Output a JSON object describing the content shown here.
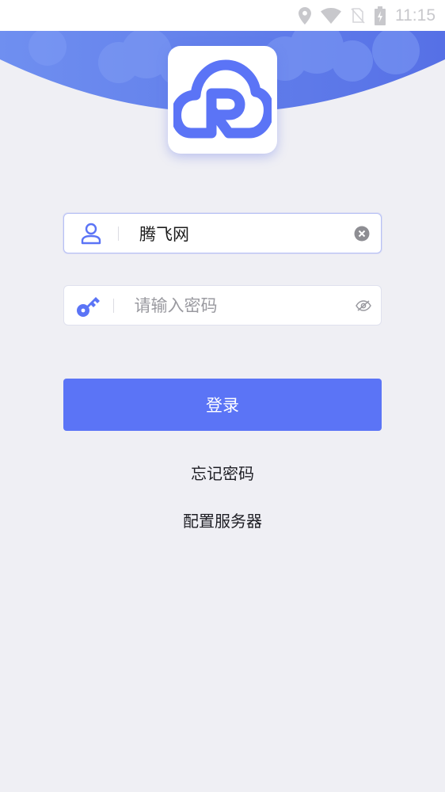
{
  "status_bar": {
    "time": "11:15",
    "icons": [
      "location-icon",
      "wifi-icon",
      "no-sim-icon",
      "battery-charging-icon"
    ]
  },
  "logo": {
    "icon": "cloud-r-logo-icon"
  },
  "username": {
    "icon": "user-icon",
    "value": "腾飞网",
    "clear_icon": "clear-icon"
  },
  "password": {
    "icon": "key-icon",
    "placeholder": "请输入密码",
    "value": "",
    "toggle_icon": "eye-hidden-icon"
  },
  "login_button": {
    "label": "登录"
  },
  "links": {
    "forgot_password": "忘记密码",
    "configure_server": "配置服务器"
  },
  "colors": {
    "accent": "#5b74f6",
    "header_blue": "#5b7ae8",
    "background": "#efeff4"
  }
}
